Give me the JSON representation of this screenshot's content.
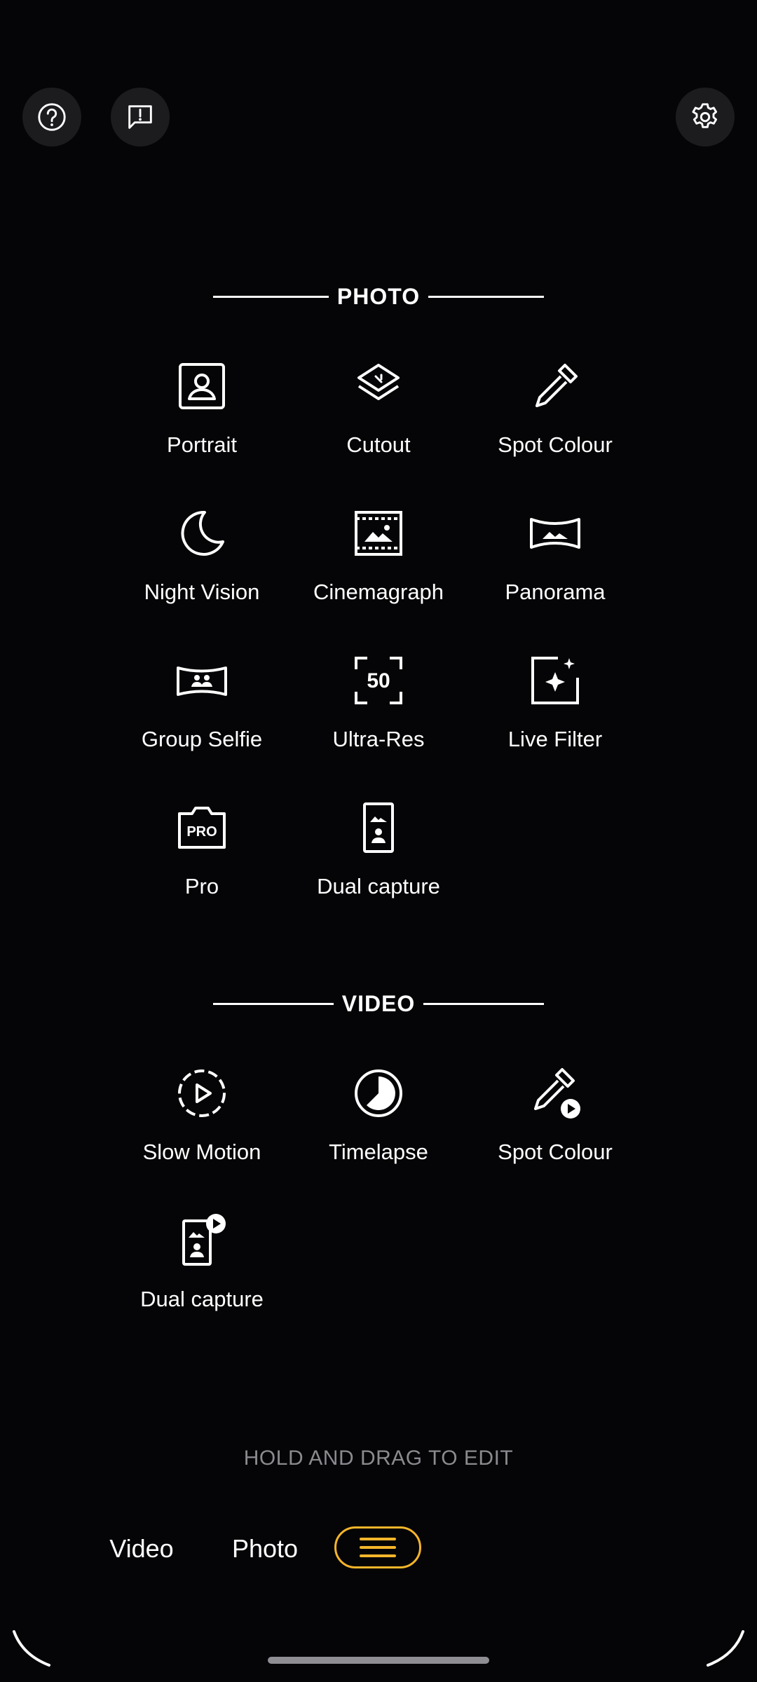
{
  "top_buttons": {
    "help": "help-icon",
    "feedback": "feedback-icon",
    "settings": "gear-icon"
  },
  "photo_section": {
    "title": "PHOTO",
    "modes": [
      {
        "label": "Portrait",
        "icon": "portrait-icon"
      },
      {
        "label": "Cutout",
        "icon": "cutout-icon"
      },
      {
        "label": "Spot Colour",
        "icon": "eyedropper-icon"
      },
      {
        "label": "Night Vision",
        "icon": "moon-icon"
      },
      {
        "label": "Cinemagraph",
        "icon": "film-icon"
      },
      {
        "label": "Panorama",
        "icon": "panorama-icon"
      },
      {
        "label": "Group Selfie",
        "icon": "group-selfie-icon"
      },
      {
        "label": "Ultra-Res",
        "icon": "ultra-res-50-icon"
      },
      {
        "label": "Live Filter",
        "icon": "sparkle-icon"
      },
      {
        "label": "Pro",
        "icon": "pro-camera-icon"
      },
      {
        "label": "Dual capture",
        "icon": "dual-capture-icon"
      }
    ]
  },
  "video_section": {
    "title": "VIDEO",
    "modes": [
      {
        "label": "Slow Motion",
        "icon": "slow-motion-icon"
      },
      {
        "label": "Timelapse",
        "icon": "timelapse-icon"
      },
      {
        "label": "Spot Colour",
        "icon": "eyedropper-video-icon"
      },
      {
        "label": "Dual capture",
        "icon": "dual-capture-video-icon"
      }
    ]
  },
  "hint": "HOLD AND DRAG TO EDIT",
  "bottom_tabs": {
    "video": "Video",
    "photo": "Photo",
    "menu_icon": "hamburger-icon"
  },
  "colors": {
    "background": "#050507",
    "accent": "#f5b52a",
    "hint_text": "#8a8a8f"
  }
}
